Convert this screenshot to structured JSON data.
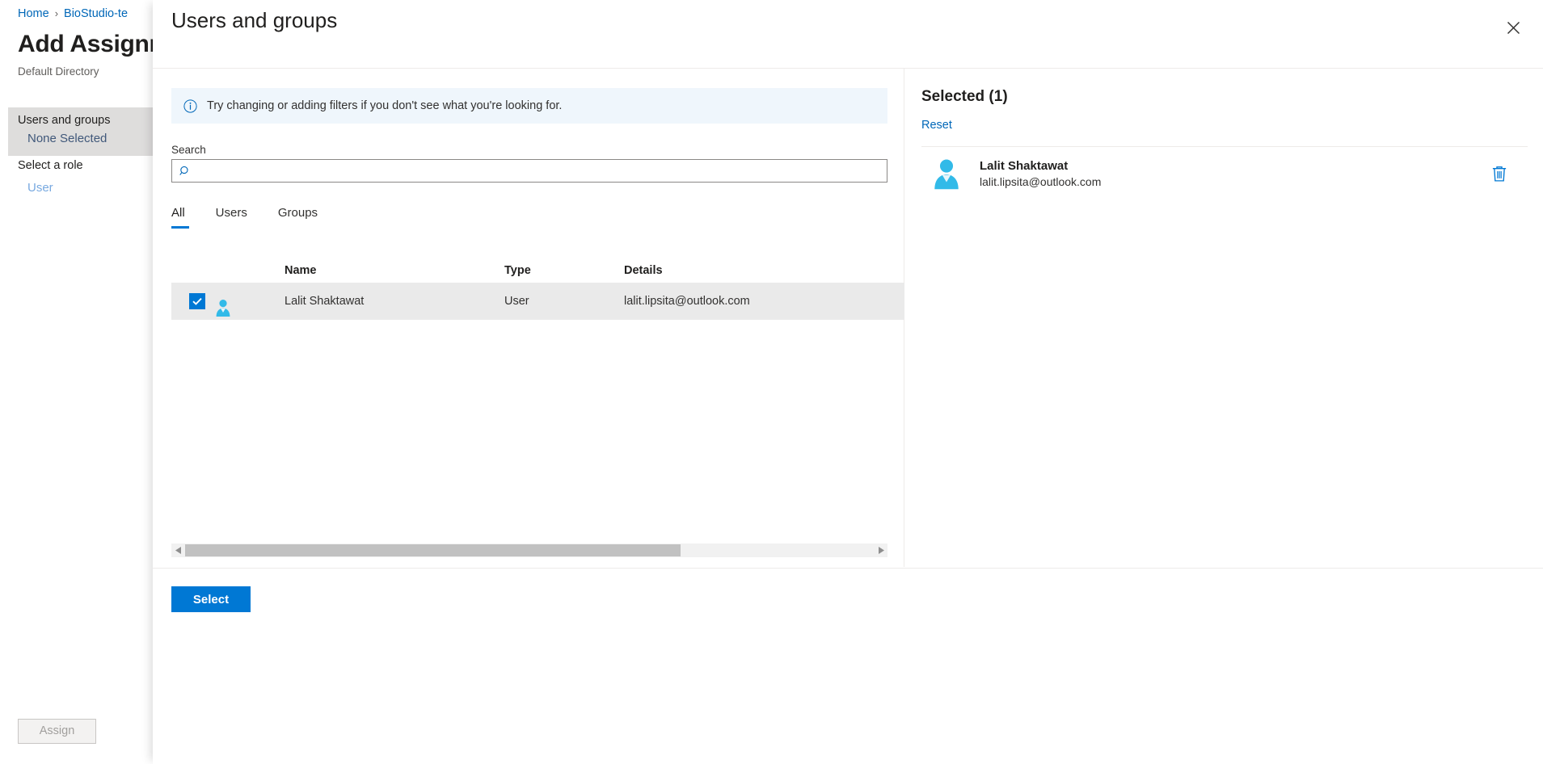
{
  "background": {
    "breadcrumb": [
      {
        "label": "Home",
        "icon": "none"
      },
      {
        "label": "BioStudio-te",
        "icon": "chevron-right-icon"
      }
    ],
    "breadcrumb_separator": "›",
    "page_title": "Add Assignm",
    "page_subtitle": "Default Directory",
    "form": {
      "users_and_groups_label": "Users and groups",
      "users_and_groups_value": "None Selected",
      "select_a_role_label": "Select a role",
      "select_a_role_value": "User"
    },
    "assign_button_label": "Assign"
  },
  "panel": {
    "title": "Users and groups",
    "close_icon": "close-icon",
    "info_banner": {
      "icon": "info-circle-icon",
      "text": "Try changing or adding filters if you don't see what you're looking for.",
      "background_color": "#eff6fc"
    },
    "search": {
      "label": "Search",
      "value": "",
      "placeholder": "",
      "icon": "search-icon"
    },
    "tabs": [
      {
        "label": "All",
        "active": true
      },
      {
        "label": "Users",
        "active": false
      },
      {
        "label": "Groups",
        "active": false
      }
    ],
    "table": {
      "columns": [
        "",
        "",
        "Name",
        "Type",
        "Details"
      ],
      "headers": {
        "name": "Name",
        "type": "Type",
        "details": "Details"
      },
      "rows": [
        {
          "checked": true,
          "icon": "user-avatar-icon",
          "name": "Lalit Shaktawat",
          "type": "User",
          "details": "lalit.lipsita@outlook.com"
        }
      ]
    },
    "scrollbar": {
      "left_arrow_icon": "chevron-left-icon",
      "right_arrow_icon": "chevron-right-icon",
      "thumb_percent": 72
    },
    "selected": {
      "title": "Selected (1)",
      "count": 1,
      "reset_label": "Reset",
      "items": [
        {
          "icon": "user-avatar-icon",
          "name": "Lalit Shaktawat",
          "email": "lalit.lipsita@outlook.com",
          "delete_icon": "trash-icon"
        }
      ]
    },
    "footer": {
      "select_button_label": "Select"
    }
  },
  "colors": {
    "accent": "#0078d4",
    "link": "#0067b8",
    "info_background": "#eff6fc",
    "row_selected_background": "#eaeaea",
    "avatar": "#32bae8"
  }
}
